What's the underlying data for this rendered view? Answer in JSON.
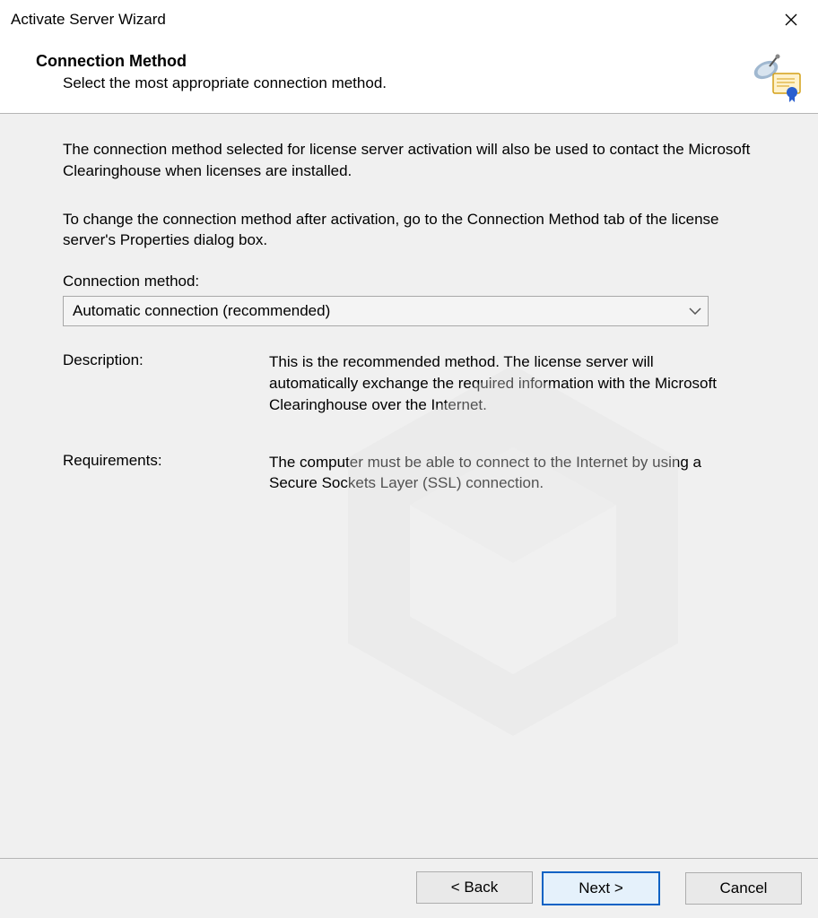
{
  "window": {
    "title": "Activate Server Wizard"
  },
  "header": {
    "title": "Connection Method",
    "subtitle": "Select the most appropriate connection method."
  },
  "body": {
    "intro1": "The connection method selected for license server activation will also be used to contact the Microsoft Clearinghouse when licenses are installed.",
    "intro2": "To change the connection method after activation, go to the Connection Method tab of the license server's Properties dialog box.",
    "connection_label": "Connection method:",
    "connection_value": "Automatic connection (recommended)",
    "description_label": "Description:",
    "description_value": "This is the recommended method. The license server will automatically exchange the required information with the Microsoft Clearinghouse over the Internet.",
    "requirements_label": "Requirements:",
    "requirements_value": "The computer must be able to connect to the Internet by using a Secure Sockets Layer (SSL) connection."
  },
  "buttons": {
    "back": "< Back",
    "next": "Next >",
    "cancel": "Cancel"
  }
}
